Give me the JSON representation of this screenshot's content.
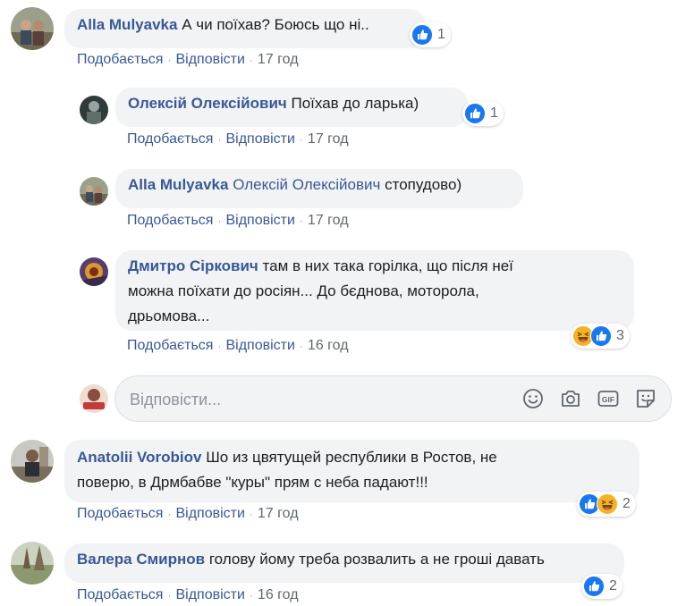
{
  "comments": [
    {
      "author": "Alla Mulyavka",
      "text": "А чи поїхав? Боюсь що ні..",
      "like": "Подобається",
      "reply": "Відповісти",
      "time": "17 год",
      "reaction_count": "1",
      "replies": [
        {
          "author": "Олексій Олексійович",
          "text": "Поїхав до ларька)",
          "like": "Подобається",
          "reply": "Відповісти",
          "time": "17 год",
          "reaction_count": "1"
        },
        {
          "author": "Alla Mulyavka",
          "mention": "Олексій Олексійович",
          "text": "стопудово)",
          "like": "Подобається",
          "reply": "Відповісти",
          "time": "17 год"
        },
        {
          "author": "Дмитро Сіркович",
          "text_line1": "там в них така горілка, що після неї",
          "text_line2": "можна поїхати до росіян... До бєднова, моторола,",
          "text_line3": "дрьомова...",
          "like": "Подобається",
          "reply": "Відповісти",
          "time": "16 год",
          "reaction_count": "3"
        }
      ]
    },
    {
      "author": "Anatolii Vorobiov",
      "text_line1": "Шо из цвятущей республики в Ростов, не",
      "text_line2": "поверю, в Дрмбабве \"куры\" прям с неба падают!!!",
      "like": "Подобається",
      "reply": "Відповісти",
      "time": "17 год",
      "reaction_count": "2"
    },
    {
      "author": "Валера Смирнов",
      "text": "голову йому треба розвалить а не гроші давать",
      "like": "Подобається",
      "reply": "Відповісти",
      "time": "16 год",
      "reaction_count": "2"
    }
  ],
  "reply_box": {
    "placeholder": "Відповісти..."
  },
  "icons": {
    "like": "like-reaction-icon",
    "haha": "haha-reaction-icon",
    "emoji": "emoji-icon",
    "camera": "camera-icon",
    "gif": "gif-icon",
    "sticker": "sticker-icon"
  },
  "colors": {
    "link": "#385898",
    "bubble": "#f2f3f5",
    "like_blue": "#1877f2",
    "haha_yellow": "#f7b125"
  }
}
